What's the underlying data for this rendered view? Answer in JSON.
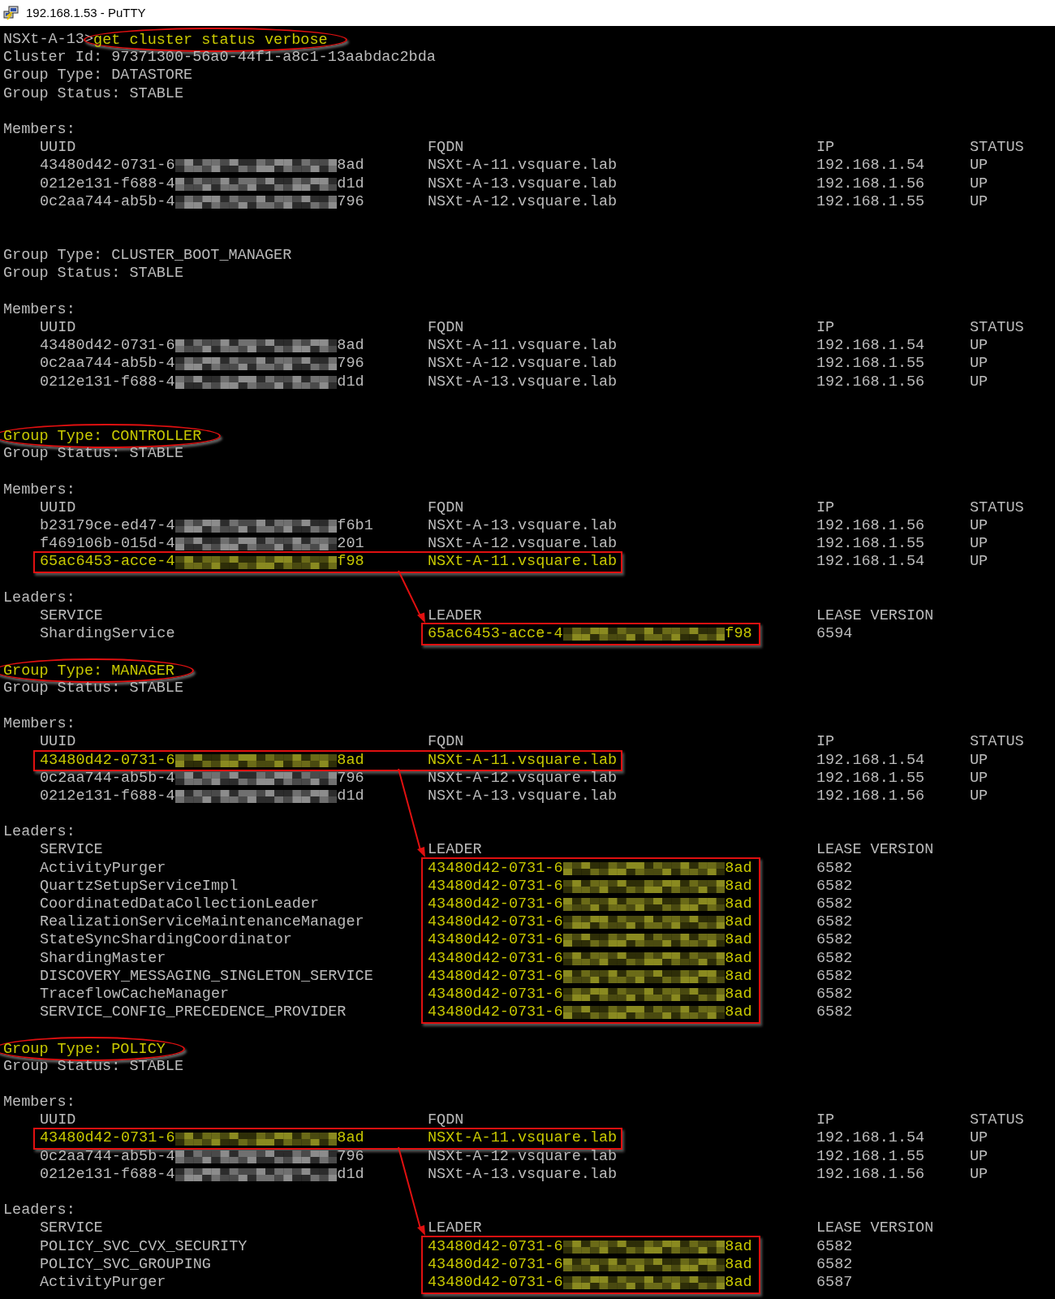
{
  "window": {
    "title": "192.168.1.53 - PuTTY"
  },
  "terminal": {
    "prompt": "NSXt-A-13>",
    "command": "get cluster status verbose",
    "command_circled": true,
    "cluster_id_line": "Cluster Id: 97371300-56a0-44f1-a8c1-13aabdac2bda",
    "groups": [
      {
        "type_line": "Group Type: DATASTORE",
        "circled": false,
        "status_line": "Group Status: STABLE",
        "members_label": "Members:",
        "member_columns": [
          "UUID",
          "FQDN",
          "IP",
          "STATUS"
        ],
        "members": [
          {
            "uuid_start": "43480d42-0731-6",
            "uuid_end": "8ad",
            "fqdn": "NSXt-A-11.vsquare.lab",
            "ip": "192.168.1.54",
            "status": "UP",
            "highlighted": false
          },
          {
            "uuid_start": "0212e131-f688-4",
            "uuid_end": "d1d",
            "fqdn": "NSXt-A-13.vsquare.lab",
            "ip": "192.168.1.56",
            "status": "UP",
            "highlighted": false
          },
          {
            "uuid_start": "0c2aa744-ab5b-4",
            "uuid_end": "796",
            "fqdn": "NSXt-A-12.vsquare.lab",
            "ip": "192.168.1.55",
            "status": "UP",
            "highlighted": false
          }
        ]
      },
      {
        "type_line": "Group Type: CLUSTER_BOOT_MANAGER",
        "circled": false,
        "status_line": "Group Status: STABLE",
        "members_label": "Members:",
        "member_columns": [
          "UUID",
          "FQDN",
          "IP",
          "STATUS"
        ],
        "members": [
          {
            "uuid_start": "43480d42-0731-6",
            "uuid_end": "8ad",
            "fqdn": "NSXt-A-11.vsquare.lab",
            "ip": "192.168.1.54",
            "status": "UP",
            "highlighted": false
          },
          {
            "uuid_start": "0c2aa744-ab5b-4",
            "uuid_end": "796",
            "fqdn": "NSXt-A-12.vsquare.lab",
            "ip": "192.168.1.55",
            "status": "UP",
            "highlighted": false
          },
          {
            "uuid_start": "0212e131-f688-4",
            "uuid_end": "d1d",
            "fqdn": "NSXt-A-13.vsquare.lab",
            "ip": "192.168.1.56",
            "status": "UP",
            "highlighted": false
          }
        ]
      },
      {
        "type_line": "Group Type: CONTROLLER",
        "circled": true,
        "status_line": "Group Status: STABLE",
        "members_label": "Members:",
        "member_columns": [
          "UUID",
          "FQDN",
          "IP",
          "STATUS"
        ],
        "members": [
          {
            "uuid_start": "b23179ce-ed47-4",
            "uuid_end": "f6b1",
            "fqdn": "NSXt-A-13.vsquare.lab",
            "ip": "192.168.1.56",
            "status": "UP",
            "highlighted": false
          },
          {
            "uuid_start": "f469106b-015d-4",
            "uuid_end": "201",
            "fqdn": "NSXt-A-12.vsquare.lab",
            "ip": "192.168.1.55",
            "status": "UP",
            "highlighted": false
          },
          {
            "uuid_start": "65ac6453-acce-4",
            "uuid_end": "f98",
            "fqdn": "NSXt-A-11.vsquare.lab",
            "ip": "192.168.1.54",
            "status": "UP",
            "highlighted": true
          }
        ],
        "leaders_label": "Leaders:",
        "leader_columns": [
          "SERVICE",
          "LEADER",
          "LEASE VERSION"
        ],
        "leaders_highlighted": true,
        "leaders": [
          {
            "service": "ShardingService",
            "uuid_start": "65ac6453-acce-4",
            "uuid_end": "f98",
            "lease_version": "6594"
          }
        ]
      },
      {
        "type_line": "Group Type: MANAGER",
        "circled": true,
        "status_line": "Group Status: STABLE",
        "members_label": "Members:",
        "member_columns": [
          "UUID",
          "FQDN",
          "IP",
          "STATUS"
        ],
        "members": [
          {
            "uuid_start": "43480d42-0731-6",
            "uuid_end": "8ad",
            "fqdn": "NSXt-A-11.vsquare.lab",
            "ip": "192.168.1.54",
            "status": "UP",
            "highlighted": true
          },
          {
            "uuid_start": "0c2aa744-ab5b-4",
            "uuid_end": "796",
            "fqdn": "NSXt-A-12.vsquare.lab",
            "ip": "192.168.1.55",
            "status": "UP",
            "highlighted": false
          },
          {
            "uuid_start": "0212e131-f688-4",
            "uuid_end": "d1d",
            "fqdn": "NSXt-A-13.vsquare.lab",
            "ip": "192.168.1.56",
            "status": "UP",
            "highlighted": false
          }
        ],
        "leaders_label": "Leaders:",
        "leader_columns": [
          "SERVICE",
          "LEADER",
          "LEASE VERSION"
        ],
        "leaders_highlighted": true,
        "leaders": [
          {
            "service": "ActivityPurger",
            "uuid_start": "43480d42-0731-6",
            "uuid_end": "8ad",
            "lease_version": "6582"
          },
          {
            "service": "QuartzSetupServiceImpl",
            "uuid_start": "43480d42-0731-6",
            "uuid_end": "8ad",
            "lease_version": "6582"
          },
          {
            "service": "CoordinatedDataCollectionLeader",
            "uuid_start": "43480d42-0731-6",
            "uuid_end": "8ad",
            "lease_version": "6582"
          },
          {
            "service": "RealizationServiceMaintenanceManager",
            "uuid_start": "43480d42-0731-6",
            "uuid_end": "8ad",
            "lease_version": "6582"
          },
          {
            "service": "StateSyncShardingCoordinator",
            "uuid_start": "43480d42-0731-6",
            "uuid_end": "8ad",
            "lease_version": "6582"
          },
          {
            "service": "ShardingMaster",
            "uuid_start": "43480d42-0731-6",
            "uuid_end": "8ad",
            "lease_version": "6582"
          },
          {
            "service": "DISCOVERY_MESSAGING_SINGLETON_SERVICE",
            "uuid_start": "43480d42-0731-6",
            "uuid_end": "8ad",
            "lease_version": "6582"
          },
          {
            "service": "TraceflowCacheManager",
            "uuid_start": "43480d42-0731-6",
            "uuid_end": "8ad",
            "lease_version": "6582"
          },
          {
            "service": "SERVICE_CONFIG_PRECEDENCE_PROVIDER",
            "uuid_start": "43480d42-0731-6",
            "uuid_end": "8ad",
            "lease_version": "6582"
          }
        ]
      },
      {
        "type_line": "Group Type: POLICY",
        "circled": true,
        "status_line": "Group Status: STABLE",
        "members_label": "Members:",
        "member_columns": [
          "UUID",
          "FQDN",
          "IP",
          "STATUS"
        ],
        "members": [
          {
            "uuid_start": "43480d42-0731-6",
            "uuid_end": "8ad",
            "fqdn": "NSXt-A-11.vsquare.lab",
            "ip": "192.168.1.54",
            "status": "UP",
            "highlighted": true
          },
          {
            "uuid_start": "0c2aa744-ab5b-4",
            "uuid_end": "796",
            "fqdn": "NSXt-A-12.vsquare.lab",
            "ip": "192.168.1.55",
            "status": "UP",
            "highlighted": false
          },
          {
            "uuid_start": "0212e131-f688-4",
            "uuid_end": "d1d",
            "fqdn": "NSXt-A-13.vsquare.lab",
            "ip": "192.168.1.56",
            "status": "UP",
            "highlighted": false
          }
        ],
        "leaders_label": "Leaders:",
        "leader_columns": [
          "SERVICE",
          "LEADER",
          "LEASE VERSION"
        ],
        "leaders_highlighted": true,
        "leaders": [
          {
            "service": "POLICY_SVC_CVX_SECURITY",
            "uuid_start": "43480d42-0731-6",
            "uuid_end": "8ad",
            "lease_version": "6582"
          },
          {
            "service": "POLICY_SVC_GROUPING",
            "uuid_start": "43480d42-0731-6",
            "uuid_end": "8ad",
            "lease_version": "6582"
          },
          {
            "service": "ActivityPurger",
            "uuid_start": "43480d42-0731-6",
            "uuid_end": "8ad",
            "lease_version": "6587"
          }
        ]
      }
    ]
  }
}
